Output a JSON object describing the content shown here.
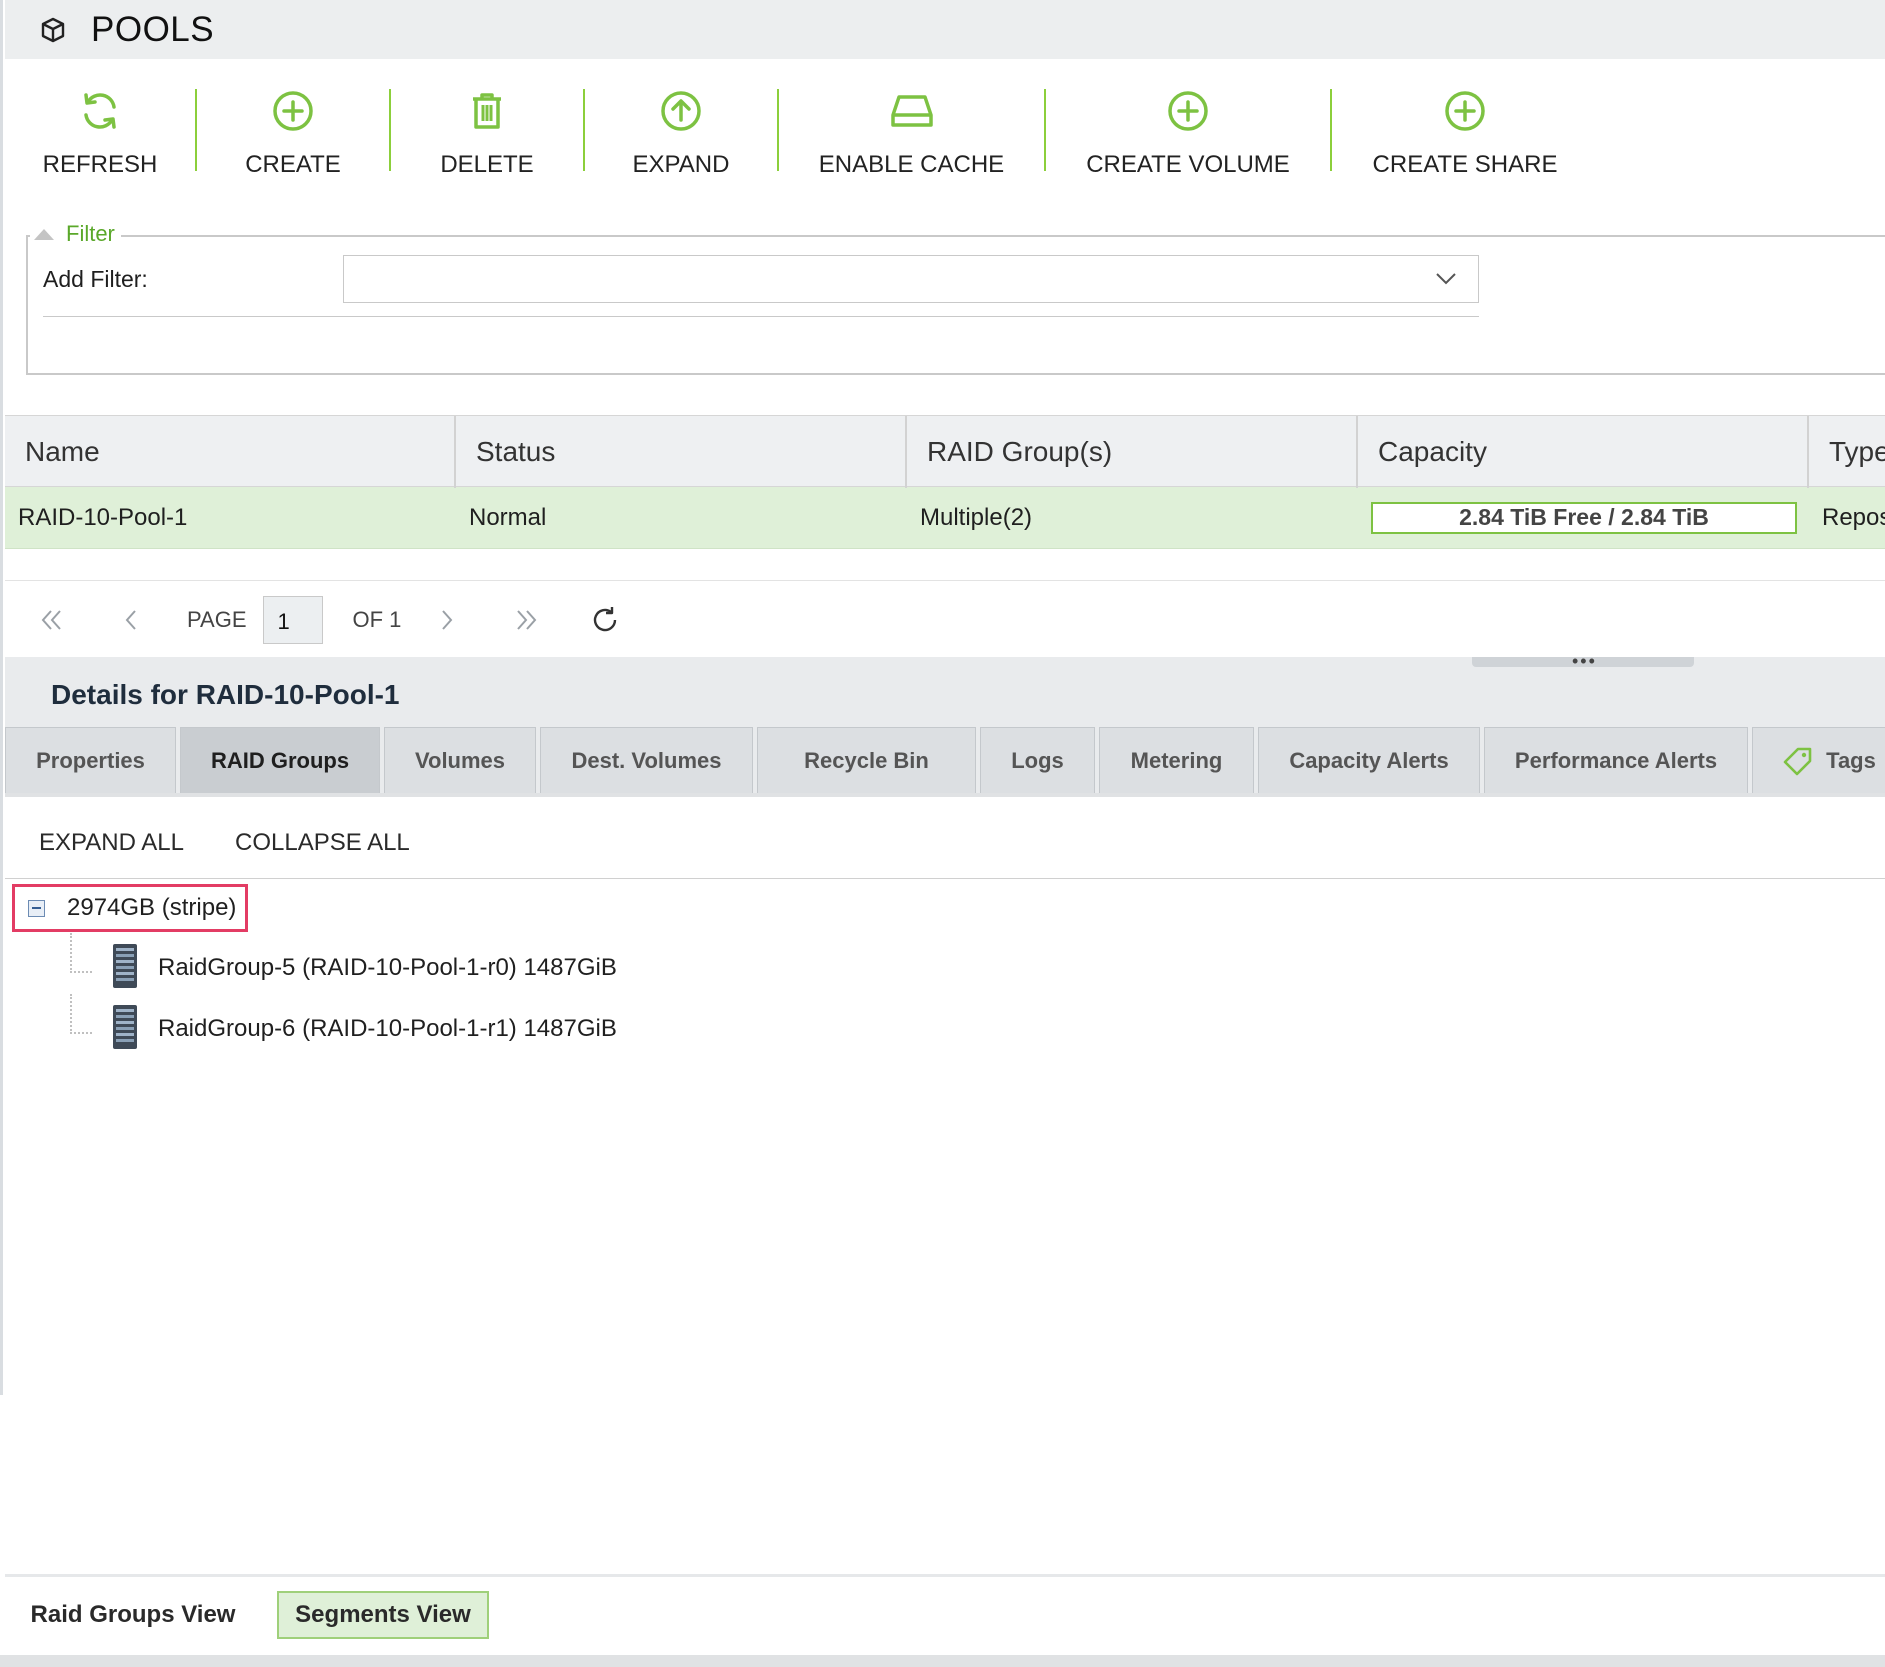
{
  "app": {
    "title": "POOLS",
    "title_icon": "cube-icon"
  },
  "toolbar": {
    "accent_color": "#7dc242",
    "items": [
      {
        "label": "REFRESH",
        "icon": "refresh-icon"
      },
      {
        "label": "CREATE",
        "icon": "plus-circle-icon"
      },
      {
        "label": "DELETE",
        "icon": "trash-icon"
      },
      {
        "label": "EXPAND",
        "icon": "arrow-up-circle-icon"
      },
      {
        "label": "ENABLE CACHE",
        "icon": "drive-icon"
      },
      {
        "label": "CREATE VOLUME",
        "icon": "plus-circle-icon"
      },
      {
        "label": "CREATE SHARE",
        "icon": "plus-circle-icon"
      }
    ]
  },
  "filter": {
    "legend": "Filter",
    "add_filter_label": "Add Filter:",
    "value": ""
  },
  "grid": {
    "columns": [
      "Name",
      "Status",
      "RAID Group(s)",
      "Capacity",
      "Type"
    ],
    "rows": [
      {
        "name": "RAID-10-Pool-1",
        "status": "Normal",
        "raid_groups": "Multiple(2)",
        "capacity": "2.84 TiB Free / 2.84 TiB",
        "capacity_free_fraction": 1.0,
        "type": "Repos"
      }
    ],
    "selected_row_color": "#dff0d8"
  },
  "pager": {
    "page_label": "PAGE",
    "page_value": "1",
    "of_label": "OF 1"
  },
  "details": {
    "title": "Details for RAID-10-Pool-1",
    "tabs": [
      "Properties",
      "RAID Groups",
      "Volumes",
      "Dest. Volumes",
      "Recycle Bin",
      "Logs",
      "Metering",
      "Capacity Alerts",
      "Performance Alerts",
      "Tags"
    ],
    "active_tab": "RAID Groups",
    "expand_all": "EXPAND ALL",
    "collapse_all": "COLLAPSE ALL"
  },
  "tree": {
    "root": {
      "label": "2974GB (stripe)",
      "expanded": true
    },
    "children": [
      {
        "label": "RaidGroup-5 (RAID-10-Pool-1-r0) 1487GiB",
        "icon": "disk-array-icon"
      },
      {
        "label": "RaidGroup-6 (RAID-10-Pool-1-r1) 1487GiB",
        "icon": "disk-array-icon"
      }
    ],
    "highlight_color": "#e33c64"
  },
  "bottom": {
    "raid_groups_view": "Raid Groups View",
    "segments_view": "Segments View",
    "selected": "Segments View"
  }
}
